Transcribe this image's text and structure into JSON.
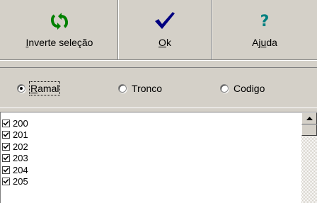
{
  "toolbar": {
    "invert": {
      "label_prefix": "",
      "label_underlined": "I",
      "label_rest": "nverte seleção",
      "icon": "refresh-icon"
    },
    "ok": {
      "label_prefix": "",
      "label_underlined": "O",
      "label_rest": "k",
      "icon": "checkmark-icon"
    },
    "help": {
      "label_prefix": "Aj",
      "label_underlined": "u",
      "label_rest": "da",
      "icon": "question-icon"
    }
  },
  "radios": [
    {
      "prefix": "",
      "underlined": "R",
      "rest": "amal",
      "selected": true
    },
    {
      "prefix": "",
      "underlined": "",
      "rest": "Tronco",
      "selected": false
    },
    {
      "prefix": "",
      "underlined": "",
      "rest": "Codigo",
      "selected": false
    }
  ],
  "list": {
    "items": [
      {
        "value": "200",
        "checked": true
      },
      {
        "value": "201",
        "checked": true
      },
      {
        "value": "202",
        "checked": true
      },
      {
        "value": "203",
        "checked": true
      },
      {
        "value": "204",
        "checked": true
      },
      {
        "value": "205",
        "checked": true
      }
    ]
  },
  "colors": {
    "refresh_green": "#008000",
    "check_navy": "#000080",
    "help_teal": "#008080",
    "window_bg": "#d4d0c8"
  }
}
